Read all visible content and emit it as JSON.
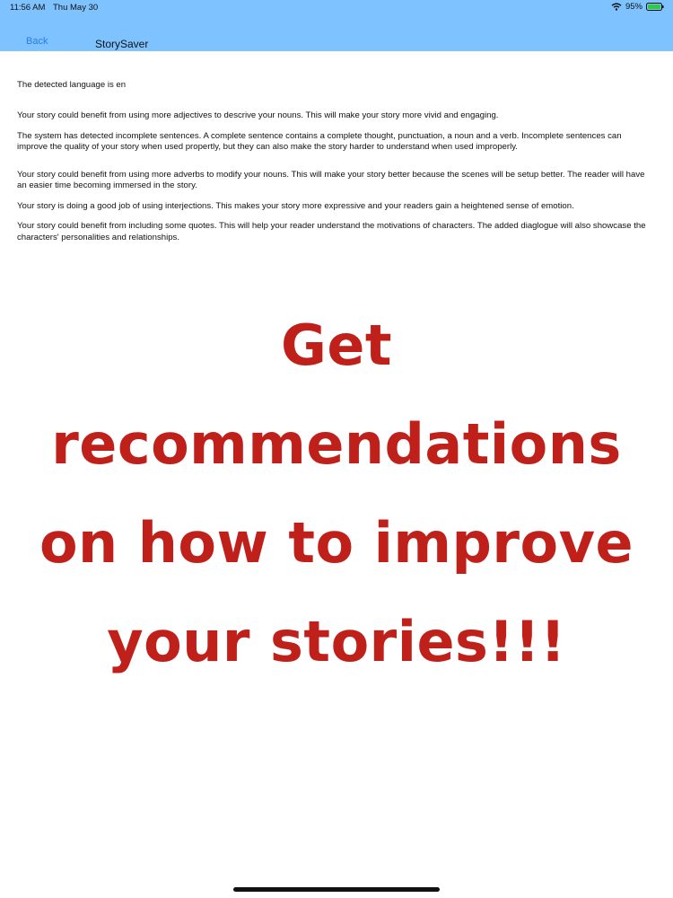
{
  "status_bar": {
    "time": "11:56 AM",
    "date": "Thu May 30",
    "battery": "95%",
    "icons": [
      "wifi-icon",
      "battery-icon"
    ]
  },
  "nav": {
    "back_label": "Back",
    "title": "StorySaver"
  },
  "content": {
    "language_line": "The detected language is en",
    "suggestions": [
      "Your story could benefit from using more adjectives to descrive your nouns. This will make your story more vivid and engaging.",
      "The system has detected incomplete sentences. A complete sentence contains a complete thought, punctuation, a noun and a verb. Incomplete sentences can improve the quality of your story when used propertly, but they can also make the story harder to understand when used improperly.",
      "Your story could benefit from using more adverbs to modify your nouns. This will make your story better because the scenes will be setup better. The reader will have an easier time becoming immersed in the story.",
      "Your story is doing a good job of using interjections. This makes your story more expressive and your readers gain a heightened sense of emotion.",
      "Your story could benefit from including some quotes. This will help your reader understand the motivations of characters. The added diaglogue will also showcase the characters' personalities and relationships."
    ]
  },
  "promo": {
    "lines": [
      "Get",
      "recommendations",
      "on how to improve",
      "your stories!!!"
    ]
  },
  "colors": {
    "nav_bar": "#7ec3ff",
    "back_link": "#2a7de1",
    "promo_text": "#c0201a"
  }
}
